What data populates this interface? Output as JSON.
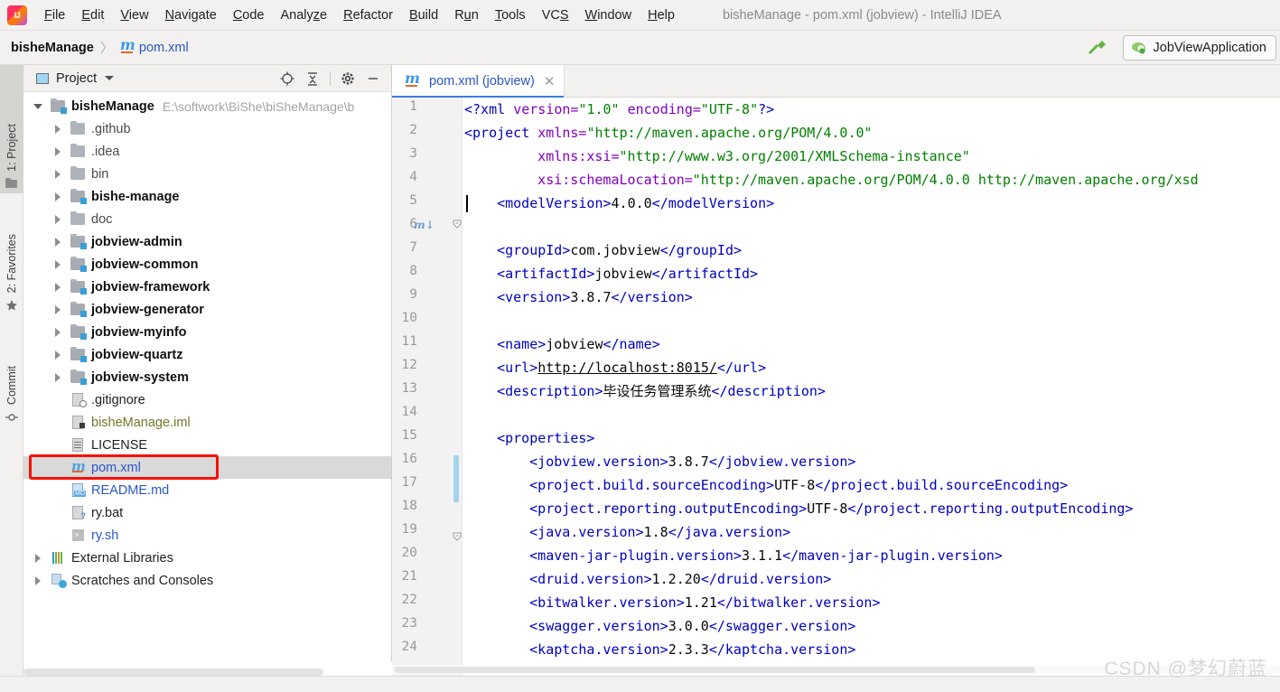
{
  "window": {
    "title": "bisheManage - pom.xml (jobview) - IntelliJ IDEA",
    "logo_icon": "intellij-idea-logo"
  },
  "menubar": {
    "items": [
      {
        "label": "File",
        "mnemonic": "F"
      },
      {
        "label": "Edit",
        "mnemonic": "E"
      },
      {
        "label": "View",
        "mnemonic": "V"
      },
      {
        "label": "Navigate",
        "mnemonic": "N"
      },
      {
        "label": "Code",
        "mnemonic": "C"
      },
      {
        "label": "Analyze",
        "mnemonic": "z"
      },
      {
        "label": "Refactor",
        "mnemonic": "R"
      },
      {
        "label": "Build",
        "mnemonic": "B"
      },
      {
        "label": "Run",
        "mnemonic": "u"
      },
      {
        "label": "Tools",
        "mnemonic": "T"
      },
      {
        "label": "VCS",
        "mnemonic": "S"
      },
      {
        "label": "Window",
        "mnemonic": "W"
      },
      {
        "label": "Help",
        "mnemonic": "H"
      }
    ]
  },
  "navbar": {
    "breadcrumb_root": "bisheManage",
    "breadcrumb_sep": "〉",
    "breadcrumb_file": "pom.xml",
    "build_icon": "hammer-icon",
    "run_config": "JobViewApplication",
    "run_config_icon": "tomcat-icon"
  },
  "toolstrip": {
    "tabs": [
      {
        "label": "1: Project",
        "icon": "project-folder-icon",
        "active": true
      },
      {
        "label": "2: Favorites",
        "icon": "star-icon",
        "active": false
      },
      {
        "label": "Commit",
        "icon": "commit-icon",
        "active": false
      }
    ]
  },
  "project_panel": {
    "title": "Project",
    "title_icon": "project-view-icon",
    "dropdown_icon": "chevron-down-icon",
    "tools": [
      {
        "name": "locate-icon",
        "glyph": "⊕"
      },
      {
        "name": "collapse-all-icon",
        "glyph": "⤓"
      },
      {
        "name": "settings-gear-icon",
        "glyph": "⚙"
      },
      {
        "name": "hide-panel-icon",
        "glyph": "—"
      }
    ],
    "tree": [
      {
        "label": "bisheManage",
        "sub": "E:\\softwork\\BiShe\\biSheManage\\b",
        "indent": 0,
        "arrow": "down",
        "icon": "module-folder-icon",
        "style": "bold"
      },
      {
        "label": ".github",
        "indent": 1,
        "arrow": "right",
        "icon": "folder-icon",
        "style": "norm"
      },
      {
        "label": ".idea",
        "indent": 1,
        "arrow": "right",
        "icon": "folder-icon",
        "style": "norm"
      },
      {
        "label": "bin",
        "indent": 1,
        "arrow": "right",
        "icon": "folder-icon",
        "style": "norm"
      },
      {
        "label": "bishe-manage",
        "indent": 1,
        "arrow": "right",
        "icon": "module-folder-icon",
        "style": "bold"
      },
      {
        "label": "doc",
        "indent": 1,
        "arrow": "right",
        "icon": "folder-icon",
        "style": "norm"
      },
      {
        "label": "jobview-admin",
        "indent": 1,
        "arrow": "right",
        "icon": "module-folder-icon",
        "style": "bold"
      },
      {
        "label": "jobview-common",
        "indent": 1,
        "arrow": "right",
        "icon": "module-folder-icon",
        "style": "bold"
      },
      {
        "label": "jobview-framework",
        "indent": 1,
        "arrow": "right",
        "icon": "module-folder-icon",
        "style": "bold"
      },
      {
        "label": "jobview-generator",
        "indent": 1,
        "arrow": "right",
        "icon": "module-folder-icon",
        "style": "bold"
      },
      {
        "label": "jobview-myinfo",
        "indent": 1,
        "arrow": "right",
        "icon": "module-folder-icon",
        "style": "bold"
      },
      {
        "label": "jobview-quartz",
        "indent": 1,
        "arrow": "right",
        "icon": "module-folder-icon",
        "style": "bold"
      },
      {
        "label": "jobview-system",
        "indent": 1,
        "arrow": "right",
        "icon": "module-folder-icon",
        "style": "bold"
      },
      {
        "label": ".gitignore",
        "indent": 1,
        "arrow": "none",
        "icon": "gitignore-file-icon",
        "style": "dark"
      },
      {
        "label": "bisheManage.iml",
        "indent": 1,
        "arrow": "none",
        "icon": "iml-file-icon",
        "style": "olive"
      },
      {
        "label": "LICENSE",
        "indent": 1,
        "arrow": "none",
        "icon": "text-file-icon",
        "style": "dark"
      },
      {
        "label": "pom.xml",
        "indent": 1,
        "arrow": "none",
        "icon": "maven-file-icon",
        "style": "blue",
        "selected": true,
        "highlighted": true
      },
      {
        "label": "README.md",
        "indent": 1,
        "arrow": "none",
        "icon": "markdown-file-icon",
        "style": "blue"
      },
      {
        "label": "ry.bat",
        "indent": 1,
        "arrow": "none",
        "icon": "bat-file-icon",
        "style": "dark"
      },
      {
        "label": "ry.sh",
        "indent": 1,
        "arrow": "none",
        "icon": "shell-file-icon",
        "style": "blue"
      },
      {
        "label": "External Libraries",
        "indent": 0,
        "arrow": "right",
        "icon": "libraries-icon",
        "style": "dark"
      },
      {
        "label": "Scratches and Consoles",
        "indent": 0,
        "arrow": "right",
        "icon": "scratches-icon",
        "style": "dark"
      }
    ]
  },
  "editor": {
    "tab": {
      "label": "pom.xml (jobview)",
      "icon": "maven-file-icon",
      "close_glyph": "✕"
    },
    "line_numbers": [
      1,
      2,
      3,
      4,
      5,
      6,
      7,
      8,
      9,
      10,
      11,
      12,
      13,
      14,
      15,
      16,
      17,
      18,
      19,
      20,
      21,
      22,
      23,
      24
    ],
    "lines": [
      {
        "n": 1,
        "indent": 0,
        "segments": [
          {
            "t": "<?xml ",
            "c": "tag"
          },
          {
            "t": "version=",
            "c": "attr"
          },
          {
            "t": "\"1.0\"",
            "c": "str"
          },
          {
            "t": " ",
            "c": "val"
          },
          {
            "t": "encoding=",
            "c": "attr"
          },
          {
            "t": "\"UTF-8\"",
            "c": "str"
          },
          {
            "t": "?>",
            "c": "tag"
          }
        ]
      },
      {
        "n": 2,
        "indent": 0,
        "segments": [
          {
            "t": "<project ",
            "c": "tag"
          },
          {
            "t": "xmlns=",
            "c": "attr"
          },
          {
            "t": "\"http://maven.apache.org/POM/4.0.0\"",
            "c": "str"
          }
        ]
      },
      {
        "n": 3,
        "indent": 9,
        "segments": [
          {
            "t": "xmlns:xsi=",
            "c": "attr"
          },
          {
            "t": "\"http://www.w3.org/2001/XMLSchema-instance\"",
            "c": "str"
          }
        ]
      },
      {
        "n": 4,
        "indent": 9,
        "segments": [
          {
            "t": "xsi:schemaLocation=",
            "c": "attr"
          },
          {
            "t": "\"http://maven.apache.org/POM/4.0.0 http://maven.apache.org/xsd",
            "c": "str"
          }
        ]
      },
      {
        "n": 5,
        "indent": 4,
        "segments": [
          {
            "t": "<modelVersion>",
            "c": "tag"
          },
          {
            "t": "4.0.0",
            "c": "val"
          },
          {
            "t": "</modelVersion>",
            "c": "tag"
          }
        ]
      },
      {
        "n": 6,
        "indent": 0,
        "segments": []
      },
      {
        "n": 7,
        "indent": 4,
        "segments": [
          {
            "t": "<groupId>",
            "c": "tag"
          },
          {
            "t": "com.jobview",
            "c": "val"
          },
          {
            "t": "</groupId>",
            "c": "tag"
          }
        ]
      },
      {
        "n": 8,
        "indent": 4,
        "segments": [
          {
            "t": "<artifactId>",
            "c": "tag"
          },
          {
            "t": "jobview",
            "c": "val"
          },
          {
            "t": "</artifactId>",
            "c": "tag"
          }
        ]
      },
      {
        "n": 9,
        "indent": 4,
        "segments": [
          {
            "t": "<version>",
            "c": "tag"
          },
          {
            "t": "3.8.7",
            "c": "val"
          },
          {
            "t": "</version>",
            "c": "tag"
          }
        ]
      },
      {
        "n": 10,
        "indent": 0,
        "segments": []
      },
      {
        "n": 11,
        "indent": 4,
        "segments": [
          {
            "t": "<name>",
            "c": "tag"
          },
          {
            "t": "jobview",
            "c": "val"
          },
          {
            "t": "</name>",
            "c": "tag"
          }
        ]
      },
      {
        "n": 12,
        "indent": 4,
        "segments": [
          {
            "t": "<url>",
            "c": "tag"
          },
          {
            "t": "http://localhost:8015/",
            "c": "lurl"
          },
          {
            "t": "</url>",
            "c": "tag"
          }
        ]
      },
      {
        "n": 13,
        "indent": 4,
        "segments": [
          {
            "t": "<description>",
            "c": "tag"
          },
          {
            "t": "毕设任务管理系统",
            "c": "val"
          },
          {
            "t": "</description>",
            "c": "tag"
          }
        ]
      },
      {
        "n": 14,
        "indent": 0,
        "segments": []
      },
      {
        "n": 15,
        "indent": 4,
        "segments": [
          {
            "t": "<properties>",
            "c": "tag"
          }
        ]
      },
      {
        "n": 16,
        "indent": 8,
        "segments": [
          {
            "t": "<jobview.version>",
            "c": "tag"
          },
          {
            "t": "3.8.7",
            "c": "val"
          },
          {
            "t": "</jobview.version>",
            "c": "tag"
          }
        ]
      },
      {
        "n": 17,
        "indent": 8,
        "segments": [
          {
            "t": "<project.build.sourceEncoding>",
            "c": "tag"
          },
          {
            "t": "UTF-8",
            "c": "val"
          },
          {
            "t": "</project.build.sourceEncoding>",
            "c": "tag"
          }
        ]
      },
      {
        "n": 18,
        "indent": 8,
        "segments": [
          {
            "t": "<project.reporting.outputEncoding>",
            "c": "tag"
          },
          {
            "t": "UTF-8",
            "c": "val"
          },
          {
            "t": "</project.reporting.outputEncoding>",
            "c": "tag"
          }
        ]
      },
      {
        "n": 19,
        "indent": 8,
        "segments": [
          {
            "t": "<java.version>",
            "c": "tag"
          },
          {
            "t": "1.8",
            "c": "val"
          },
          {
            "t": "</java.version>",
            "c": "tag"
          }
        ]
      },
      {
        "n": 20,
        "indent": 8,
        "segments": [
          {
            "t": "<maven-jar-plugin.version>",
            "c": "tag"
          },
          {
            "t": "3.1.1",
            "c": "val"
          },
          {
            "t": "</maven-jar-plugin.version>",
            "c": "tag"
          }
        ]
      },
      {
        "n": 21,
        "indent": 8,
        "segments": [
          {
            "t": "<druid.version>",
            "c": "tag"
          },
          {
            "t": "1.2.20",
            "c": "val"
          },
          {
            "t": "</druid.version>",
            "c": "tag"
          }
        ]
      },
      {
        "n": 22,
        "indent": 8,
        "segments": [
          {
            "t": "<bitwalker.version>",
            "c": "tag"
          },
          {
            "t": "1.21",
            "c": "val"
          },
          {
            "t": "</bitwalker.version>",
            "c": "tag"
          }
        ]
      },
      {
        "n": 23,
        "indent": 8,
        "segments": [
          {
            "t": "<swagger.version>",
            "c": "tag"
          },
          {
            "t": "3.0.0",
            "c": "val"
          },
          {
            "t": "</swagger.version>",
            "c": "tag"
          }
        ]
      },
      {
        "n": 24,
        "indent": 8,
        "segments": [
          {
            "t": "<kaptcha.version>",
            "c": "tag"
          },
          {
            "t": "2.3.3",
            "c": "val"
          },
          {
            "t": "</kaptcha.version>",
            "c": "tag"
          }
        ]
      }
    ]
  },
  "watermark": "CSDN @梦幻蔚蓝",
  "colors": {
    "accent_blue": "#2a56c6",
    "tag_blue": "#0000c0",
    "string_green": "#008000",
    "attr_purple": "#8000c0",
    "selection_red": "#f90f06",
    "change_marker": "#a6d2f0"
  }
}
